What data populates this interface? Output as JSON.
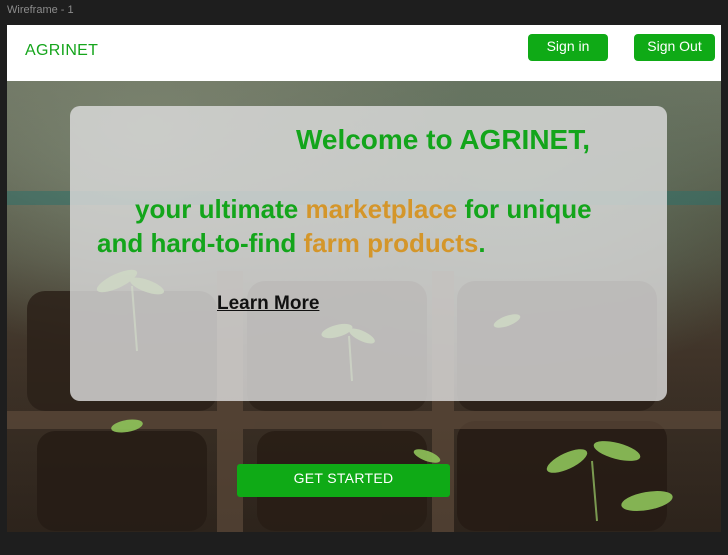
{
  "window": {
    "frame_label": "Wireframe - 1"
  },
  "nav": {
    "brand": "AGRINET",
    "sign_in_label": "Sign in",
    "sign_out_label": "Sign Out"
  },
  "hero": {
    "welcome": "Welcome to AGRINET,",
    "line1_prefix": "your ultimate ",
    "line1_highlight": "marketplace",
    "line1_suffix": " for unique",
    "line2_prefix": "and hard-to-find ",
    "line2_highlight": "farm products",
    "line2_suffix": ".",
    "learn_more_label": "Learn More",
    "cta_label": "GET STARTED"
  },
  "colors": {
    "brand_green": "#13a51b",
    "button_green": "#0faa16",
    "highlight_orange": "#d4962a"
  }
}
